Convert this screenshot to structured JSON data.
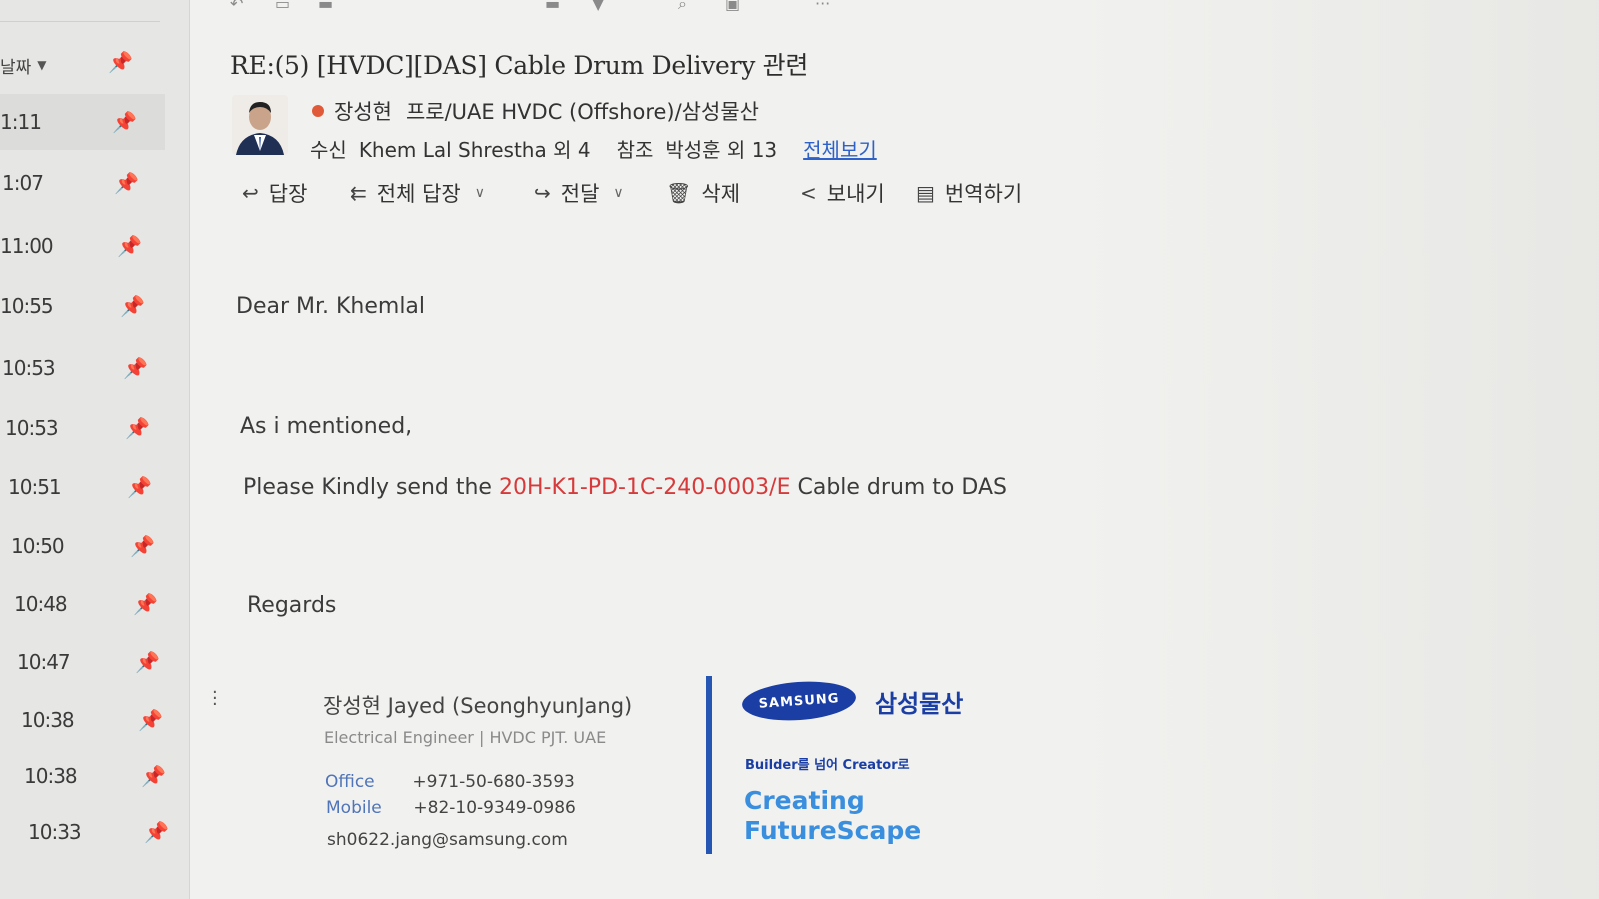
{
  "message_list": {
    "sort_label": "날짜",
    "times": [
      "1:11",
      "1:07",
      "11:00",
      "10:55",
      "10:53",
      "10:53",
      "10:51",
      "10:50",
      "10:48",
      "10:47",
      "10:38",
      "10:38",
      "10:33"
    ]
  },
  "header": {
    "subject": "RE:(5) [HVDC][DAS] Cable Drum Delivery 관련",
    "sender_name": "장성현",
    "sender_org": "프로/UAE HVDC (Offshore)/삼성물산",
    "to_label": "수신",
    "to_value": "Khem Lal Shrestha 외 4",
    "cc_label": "참조",
    "cc_value": "박성훈 외 13",
    "view_all": "전체보기"
  },
  "actions": {
    "reply": "답장",
    "reply_all": "전체 답장",
    "forward": "전달",
    "delete": "삭제",
    "send": "보내기",
    "translate": "번역하기"
  },
  "body": {
    "greeting": "Dear Mr. Khemlal",
    "line1": "As i mentioned,",
    "line2_pre": "Please Kindly send the",
    "doc_number": "20H-K1-PD-1C-240-0003/E",
    "line2_post": "Cable drum to DAS",
    "regards": "Regards"
  },
  "signature": {
    "name": "장성현  Jayed (SeonghyunJang)",
    "title": "Electrical Engineer | HVDC PJT. UAE",
    "office_label": "Office",
    "office_value": "+971-50-680-3593",
    "mobile_label": "Mobile",
    "mobile_value": "+82-10-9349-0986",
    "email": "sh0622.jang@samsung.com",
    "logo_text": "SAMSUNG",
    "company_kr": "삼성물산",
    "tagline": "Builder를 넘어 Creator로",
    "slogan_1": "Creating",
    "slogan_2": "FutureScape"
  },
  "colors": {
    "accent_blue": "#1a3ea4",
    "link_blue": "#2f62c8",
    "doc_red": "#d63a3a",
    "status_dot": "#e05a3a"
  }
}
